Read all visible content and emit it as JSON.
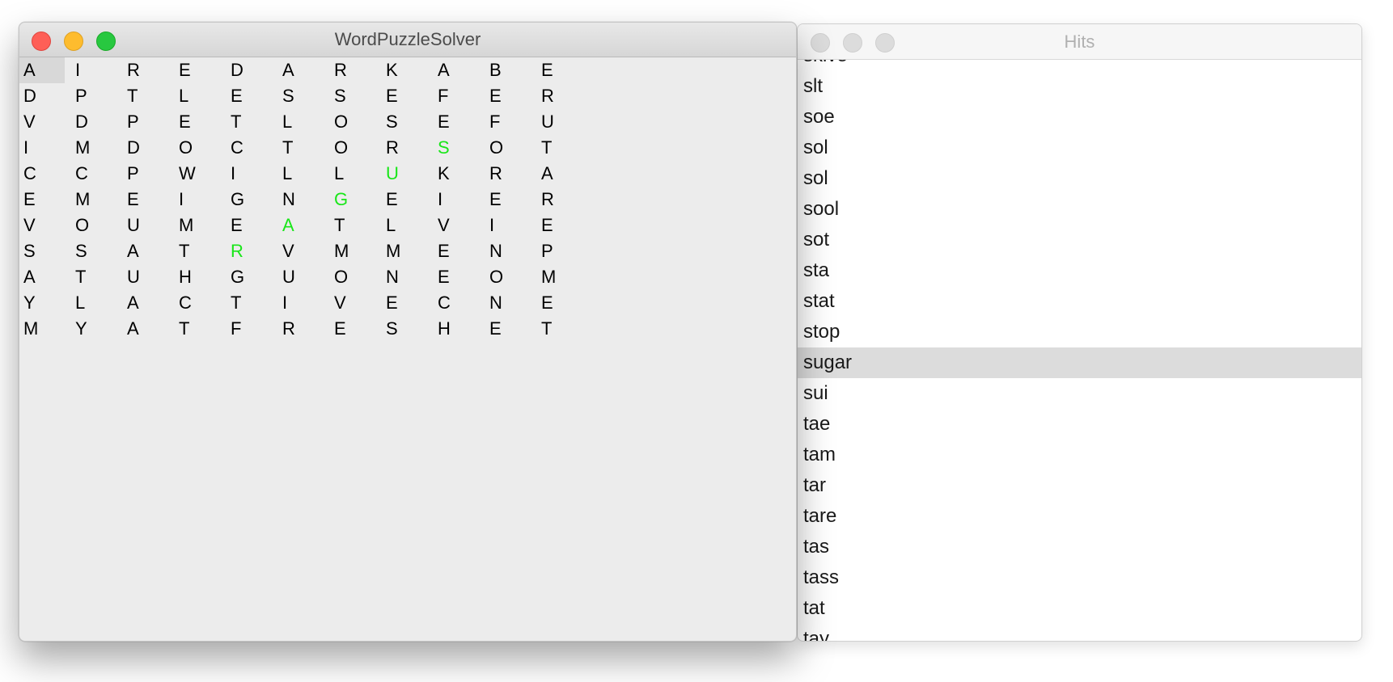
{
  "main_window": {
    "title": "WordPuzzleSolver",
    "grid": [
      [
        "A",
        "I",
        "R",
        "E",
        "D",
        "A",
        "R",
        "K",
        "A",
        "B",
        "E"
      ],
      [
        "D",
        "P",
        "T",
        "L",
        "E",
        "S",
        "S",
        "E",
        "F",
        "E",
        "R"
      ],
      [
        "V",
        "D",
        "P",
        "E",
        "T",
        "L",
        "O",
        "S",
        "E",
        "F",
        "U"
      ],
      [
        "I",
        "M",
        "D",
        "O",
        "C",
        "T",
        "O",
        "R",
        "S",
        "O",
        "T"
      ],
      [
        "C",
        "C",
        "P",
        "W",
        "I",
        "L",
        "L",
        "U",
        "K",
        "R",
        "A"
      ],
      [
        "E",
        "M",
        "E",
        "I",
        "G",
        "N",
        "G",
        "E",
        "I",
        "E",
        "R"
      ],
      [
        "V",
        "O",
        "U",
        "M",
        "E",
        "A",
        "T",
        "L",
        "V",
        "I",
        "E"
      ],
      [
        "S",
        "S",
        "A",
        "T",
        "R",
        "V",
        "M",
        "M",
        "E",
        "N",
        "P"
      ],
      [
        "A",
        "T",
        "U",
        "H",
        "G",
        "U",
        "O",
        "N",
        "E",
        "O",
        "M"
      ],
      [
        "Y",
        "L",
        "A",
        "C",
        "T",
        "I",
        "V",
        "E",
        "C",
        "N",
        "E"
      ],
      [
        "M",
        "Y",
        "A",
        "T",
        "F",
        "R",
        "E",
        "S",
        "H",
        "E",
        "T"
      ]
    ],
    "highlighted_cells": [
      [
        3,
        8
      ],
      [
        4,
        7
      ],
      [
        5,
        6
      ],
      [
        6,
        5
      ],
      [
        7,
        4
      ]
    ],
    "selected_cell": [
      0,
      0
    ],
    "highlight_color": "#19e619"
  },
  "hits_window": {
    "title": "Hits",
    "items": [
      "skive",
      "slt",
      "soe",
      "sol",
      "sol",
      "sool",
      "sot",
      "sta",
      "stat",
      "stop",
      "sugar",
      "sui",
      "tae",
      "tam",
      "tar",
      "tare",
      "tas",
      "tass",
      "tat",
      "tay"
    ],
    "selected_item": "sugar"
  }
}
